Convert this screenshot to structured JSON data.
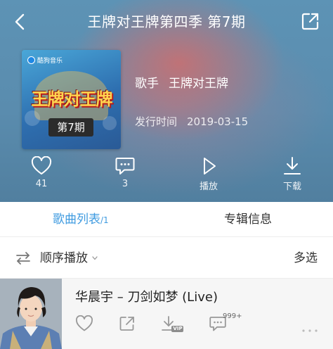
{
  "header": {
    "title": "王牌对王牌第四季 第7期",
    "back_icon": "back-chevron-icon",
    "share_icon": "share-out-icon"
  },
  "album": {
    "cover": {
      "brand": "酷狗音乐",
      "show_title": "王牌对王牌",
      "episode": "第7期"
    },
    "singer_label": "歌手",
    "singer": "王牌对王牌",
    "release_label": "发行时间",
    "release_date": "2019-03-15"
  },
  "actions": [
    {
      "icon": "heart-icon",
      "label": "41"
    },
    {
      "icon": "comment-icon",
      "label": "3"
    },
    {
      "icon": "play-icon",
      "label": "播放"
    },
    {
      "icon": "download-icon",
      "label": "下载"
    }
  ],
  "tabs": {
    "songs_label": "歌曲列表",
    "songs_count": "/1",
    "album_label": "专辑信息"
  },
  "order_row": {
    "mode": "顺序播放",
    "multi_select": "多选"
  },
  "songs": [
    {
      "title": "华晨宇 – 刀剑如梦 (Live)",
      "comment_badge": "999+",
      "download_badge": "VIP"
    }
  ],
  "colors": {
    "accent": "#3f9be0",
    "hero_blue": "#5a8cae",
    "hero_red": "#cd6e6e"
  }
}
